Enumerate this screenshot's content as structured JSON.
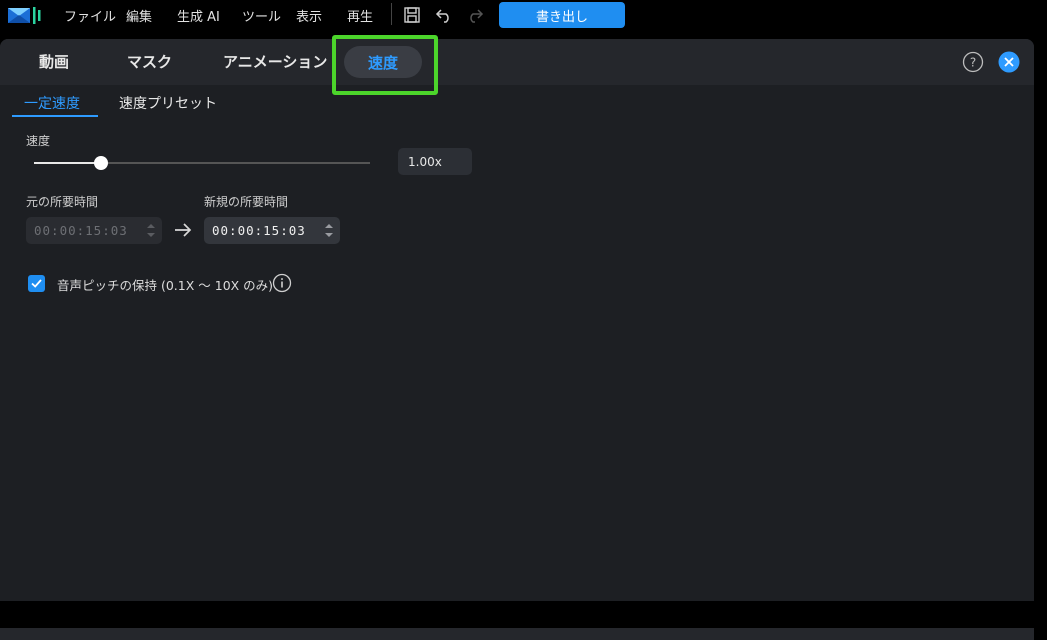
{
  "menubar": {
    "items": [
      "ファイル",
      "編集",
      "生成 AI",
      "ツール",
      "表示",
      "再生"
    ],
    "export_label": "書き出し",
    "accent": "#1f8ef1"
  },
  "tabs": {
    "items": [
      "動画",
      "マスク",
      "アニメーション"
    ],
    "active": "速度",
    "highlight_color": "#4cd52b"
  },
  "subtabs": {
    "active": "一定速度",
    "other": "速度プリセット"
  },
  "speed": {
    "label": "速度",
    "value": "1.00x",
    "slider_fraction": 0.2
  },
  "duration": {
    "original_label": "元の所要時間",
    "original_value": "00:00:15:03",
    "new_label": "新規の所要時間",
    "new_value": "00:00:15:03"
  },
  "pitch": {
    "label": "音声ピッチの保持 (0.1X 〜 10X のみ)",
    "checked": true
  },
  "icons": [
    "app-logo-icon",
    "save-icon",
    "undo-icon",
    "redo-icon",
    "help-icon",
    "close-icon",
    "arrow-right-icon",
    "info-icon",
    "checkmark-icon"
  ]
}
